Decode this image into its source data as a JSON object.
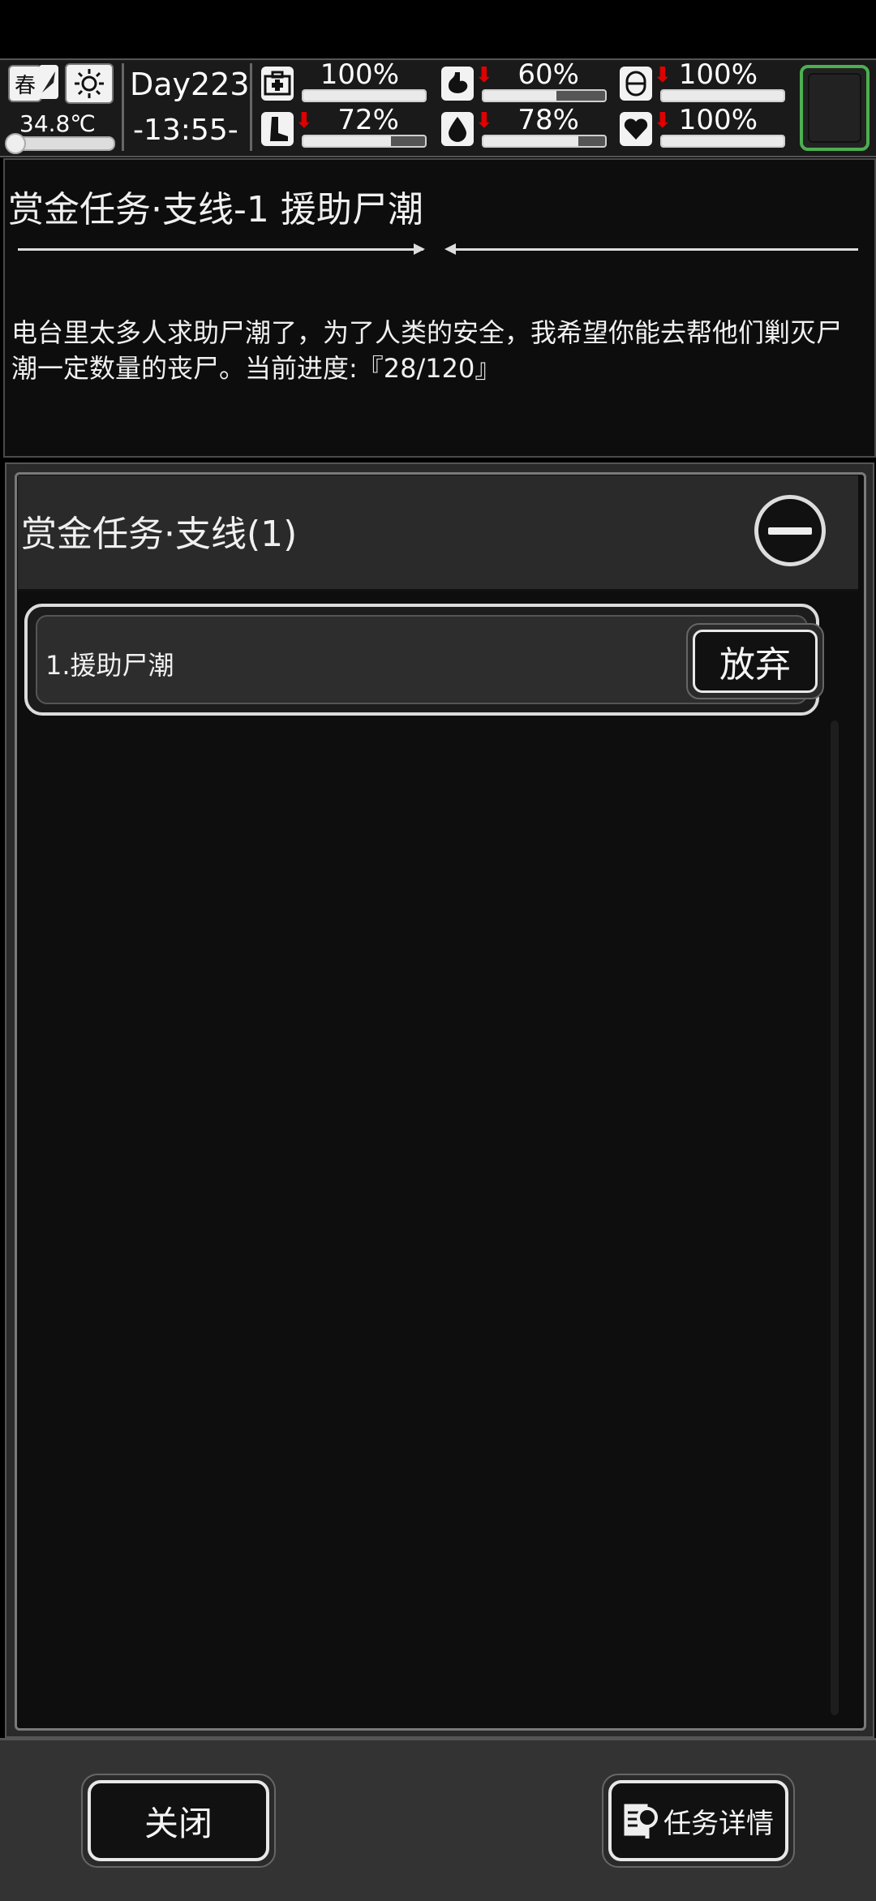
{
  "status": {
    "season": "春",
    "temperature": "34.8℃",
    "day": "Day223",
    "time": "-13:55-",
    "stats": [
      {
        "icon": "medkit-icon",
        "percent_label": "100%",
        "level": 1.0,
        "falling": false
      },
      {
        "icon": "stomach-icon",
        "percent_label": "60%",
        "level": 0.6,
        "falling": true
      },
      {
        "icon": "pill-icon",
        "percent_label": "100%",
        "level": 1.0,
        "falling": true
      },
      {
        "icon": "leg-icon",
        "percent_label": "72%",
        "level": 0.72,
        "falling": true
      },
      {
        "icon": "water-drop-icon",
        "percent_label": "78%",
        "level": 0.78,
        "falling": true
      },
      {
        "icon": "heart-icon",
        "percent_label": "100%",
        "level": 1.0,
        "falling": true
      }
    ],
    "accent_color": "#4caf50"
  },
  "detail": {
    "title": "赏金任务·支线-1 援助尸潮",
    "description": "电台里太多人求助尸潮了，为了人类的安全，我希望你能去帮他们剿灭尸潮一定数量的丧尸。当前进度:『28/120』"
  },
  "list": {
    "header": "赏金任务·支线(1)",
    "items": [
      {
        "label": "1.援助尸潮",
        "action": "放弃"
      }
    ]
  },
  "footer": {
    "close_label": "关闭",
    "details_label": "任务详情"
  }
}
